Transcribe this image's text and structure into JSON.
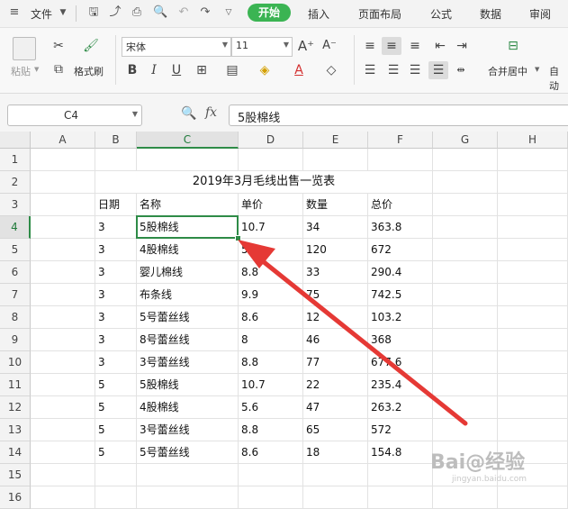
{
  "menubar": {
    "file_label": "文件",
    "start_tab": "开始",
    "tabs": [
      "插入",
      "页面布局",
      "公式",
      "数据",
      "审阅"
    ]
  },
  "ribbon": {
    "paste_label": "粘贴",
    "format_painter_label": "格式刷",
    "font_name": "宋体",
    "font_size": "11",
    "merge_center_label": "合并居中",
    "auto_wrap_label": "自动"
  },
  "formula_bar": {
    "name_box": "C4",
    "fx_label": "fx",
    "formula": "5股棉线"
  },
  "sheet": {
    "columns": [
      "A",
      "B",
      "C",
      "D",
      "E",
      "F",
      "G",
      "H"
    ],
    "rows": [
      "1",
      "2",
      "3",
      "4",
      "5",
      "6",
      "7",
      "8",
      "9",
      "10",
      "11",
      "12",
      "13",
      "14",
      "15",
      "16"
    ],
    "title": "2019年3月毛线出售一览表",
    "headers": [
      "日期",
      "名称",
      "单价",
      "数量",
      "总价"
    ],
    "data": [
      [
        "3",
        "5股棉线",
        "10.7",
        "34",
        "363.8"
      ],
      [
        "3",
        "4股棉线",
        "5.6",
        "120",
        "672"
      ],
      [
        "3",
        "婴儿棉线",
        "8.8",
        "33",
        "290.4"
      ],
      [
        "3",
        "布条线",
        "9.9",
        "75",
        "742.5"
      ],
      [
        "3",
        "5号蕾丝线",
        "8.6",
        "12",
        "103.2"
      ],
      [
        "3",
        "8号蕾丝线",
        "8",
        "46",
        "368"
      ],
      [
        "3",
        "3号蕾丝线",
        "8.8",
        "77",
        "677.6"
      ],
      [
        "5",
        "5股棉线",
        "10.7",
        "22",
        "235.4"
      ],
      [
        "5",
        "4股棉线",
        "5.6",
        "47",
        "263.2"
      ],
      [
        "5",
        "3号蕾丝线",
        "8.8",
        "65",
        "572"
      ],
      [
        "5",
        "5号蕾丝线",
        "8.6",
        "18",
        "154.8"
      ]
    ]
  },
  "watermark": {
    "main": "Bai@经验",
    "sub": "jingyan.baidu.com"
  },
  "colors": {
    "accent_green": "#2e8b47",
    "start_tab_bg": "#3bb453",
    "arrow_red": "#e53935"
  }
}
